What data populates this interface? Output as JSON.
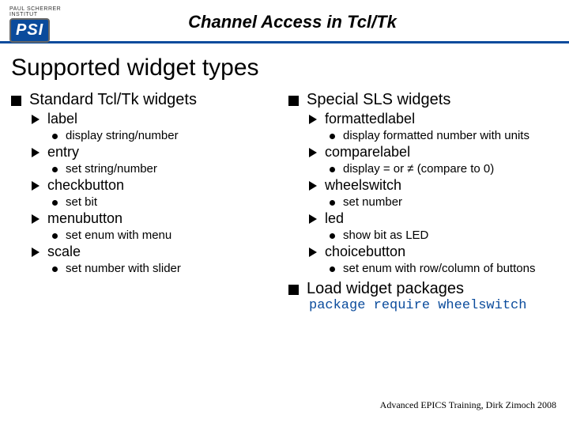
{
  "logo": {
    "topline": "PAUL SCHERRER INSTITUT",
    "text": "PSI"
  },
  "slide_title": "Channel Access in Tcl/Tk",
  "page_title": "Supported widget types",
  "left": {
    "heading": "Standard Tcl/Tk widgets",
    "items": [
      {
        "name": "label",
        "sub": [
          "display string/number"
        ]
      },
      {
        "name": "entry",
        "sub": [
          "set string/number"
        ]
      },
      {
        "name": "checkbutton",
        "sub": [
          "set bit"
        ]
      },
      {
        "name": "menubutton",
        "sub": [
          "set enum with menu"
        ]
      },
      {
        "name": "scale",
        "sub": [
          "set number with slider"
        ]
      }
    ]
  },
  "right": {
    "heading": "Special SLS widgets",
    "items": [
      {
        "name": "formattedlabel",
        "sub": [
          "display formatted number with units"
        ]
      },
      {
        "name": "comparelabel",
        "sub": [
          "display = or ≠ (compare to 0)"
        ]
      },
      {
        "name": "wheelswitch",
        "sub": [
          "set number"
        ]
      },
      {
        "name": "led",
        "sub": [
          "show bit as LED"
        ]
      },
      {
        "name": "choicebutton",
        "sub": [
          "set enum with row/column of buttons"
        ]
      }
    ],
    "heading2": "Load widget packages",
    "code": "package require wheelswitch"
  },
  "footer": "Advanced EPICS Training, Dirk Zimoch 2008"
}
